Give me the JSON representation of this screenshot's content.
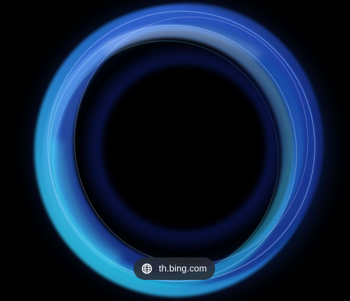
{
  "image": {
    "subject_icon": "glowing-blue-ring",
    "background_color": "#000000"
  },
  "source_badge": {
    "text": "th.bing.com",
    "icon": "globe-icon"
  },
  "colors": {
    "ring_cyan": "#2fd3e6",
    "ring_blue": "#2a5fd0",
    "ring_navy": "#0c1d6b",
    "pill_bg": "#282c34"
  }
}
